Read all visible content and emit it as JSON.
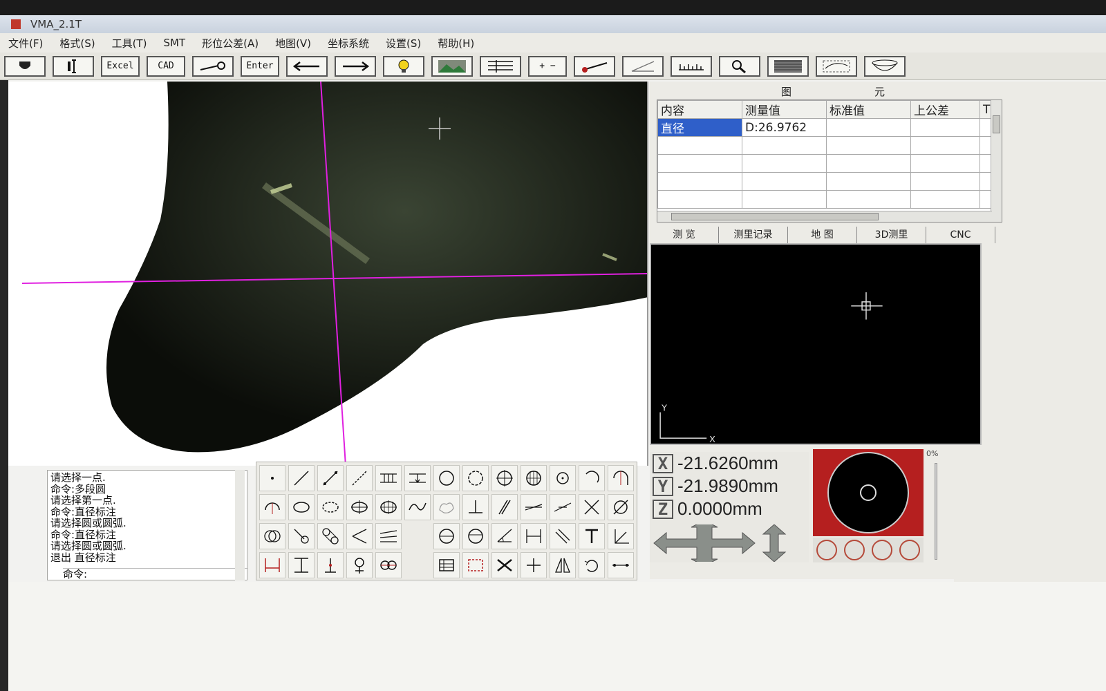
{
  "window": {
    "title": "VMA_2.1T"
  },
  "menu": [
    "文件(F)",
    "格式(S)",
    "工具(T)",
    "SMT",
    "形位公差(A)",
    "地图(V)",
    "坐标系统",
    "设置(S)",
    "帮助(H)"
  ],
  "toolbar": {
    "excel_label": "Excel",
    "cad_label": "CAD",
    "enter_label": "Enter",
    "plus_minus_label": "+ −"
  },
  "elements_panel": {
    "title": "图元",
    "columns": [
      "内容",
      "测量值",
      "标准值",
      "上公差",
      "T"
    ],
    "rows": [
      {
        "content": "直径",
        "measured": "D:26.9762",
        "standard": "",
        "upper_tol": ""
      }
    ]
  },
  "tabs": [
    "测 览",
    "测里记录",
    "地 图",
    "3D测里",
    "CNC"
  ],
  "preview": {
    "y_axis_label": "Y",
    "x_axis_label": "X"
  },
  "coordinates": {
    "x": {
      "axis": "X",
      "value": "-21.6260mm"
    },
    "y": {
      "axis": "Y",
      "value": "-21.9890mm"
    },
    "z": {
      "axis": "Z",
      "value": "0.0000mm"
    }
  },
  "progress": {
    "label": "0%",
    "value": 0
  },
  "command_log": {
    "lines": [
      "请选择一点.",
      "命令:多段圆",
      "请选择第一点.",
      "命令:直径标注",
      "请选择圆或圆弧.",
      "命令:直径标注",
      "请选择圆或圆弧.",
      "退出 直径标注"
    ],
    "prompt": "命令:"
  },
  "colors": {
    "crosshair": "#e020e0",
    "wafer_background": "#b51f1f",
    "selection": "#2f5fc9"
  }
}
